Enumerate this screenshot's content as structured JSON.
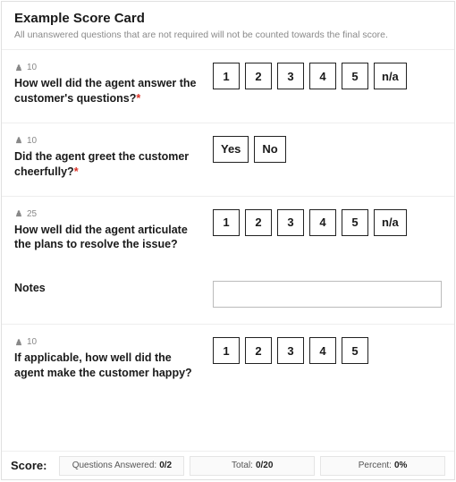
{
  "header": {
    "title": "Example Score Card",
    "subtitle": "All unanswered questions that are not required will not be counted towards the final score."
  },
  "questions": [
    {
      "weight": "10",
      "text": "How well did the agent answer the customer's questions?",
      "required": true,
      "options": [
        "1",
        "2",
        "3",
        "4",
        "5",
        "n/a"
      ]
    },
    {
      "weight": "10",
      "text": "Did the agent greet the customer cheerfully?",
      "required": true,
      "options": [
        "Yes",
        "No"
      ]
    },
    {
      "weight": "25",
      "text": "How well did the agent articulate the plans to resolve the issue?",
      "required": false,
      "options": [
        "1",
        "2",
        "3",
        "4",
        "5",
        "n/a"
      ]
    },
    {
      "weight": "10",
      "text": "If applicable, how well did the agent make the customer happy?",
      "required": false,
      "options": [
        "1",
        "2",
        "3",
        "4",
        "5"
      ]
    }
  ],
  "notes": {
    "label": "Notes",
    "value": ""
  },
  "required_marker": "*",
  "footer": {
    "score_label": "Score:",
    "answered_label": "Questions Answered:",
    "answered_value": "0/2",
    "total_label": "Total:",
    "total_value": "0/20",
    "percent_label": "Percent:",
    "percent_value": "0%"
  }
}
